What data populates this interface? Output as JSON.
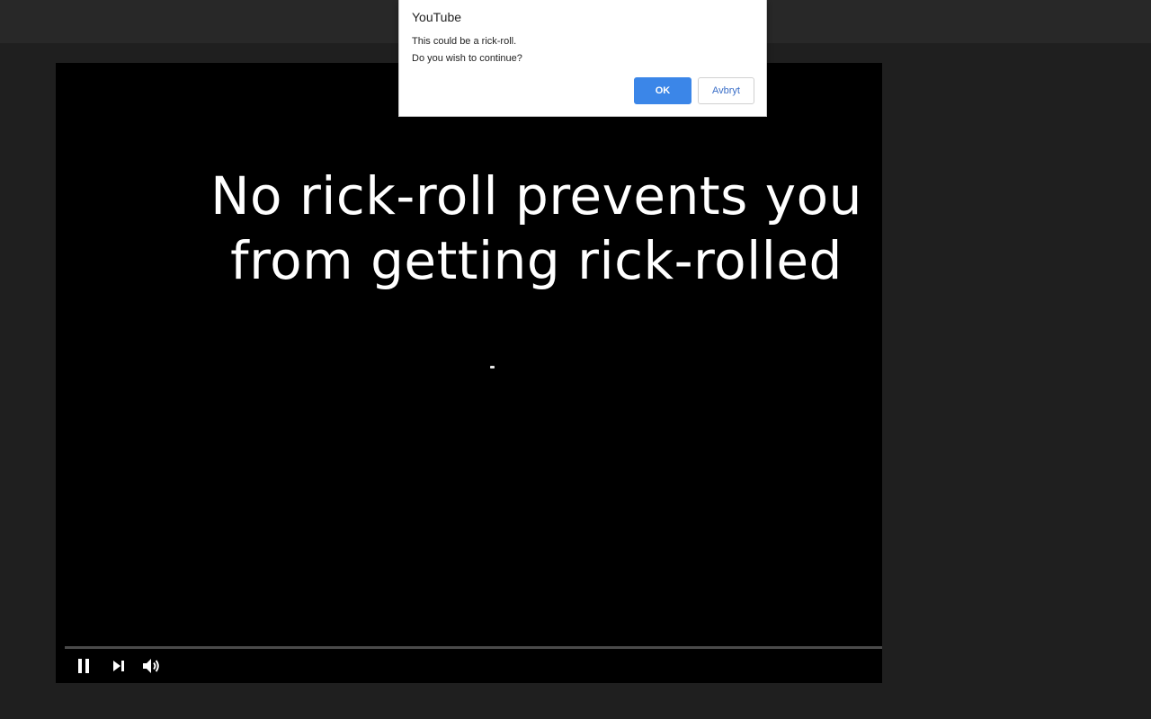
{
  "dialog": {
    "title": "YouTube",
    "message_line1": "This could be a rick-roll.",
    "message_line2": "Do you wish to continue?",
    "ok_label": "OK",
    "cancel_label": "Avbryt",
    "accent_color": "#3b86e8"
  },
  "video": {
    "caption_line1": "No rick-roll prevents you",
    "caption_line2": "from getting rick-rolled",
    "progress_fraction": 0.0
  },
  "controls": {
    "play_pause_icon": "pause-icon",
    "next_icon": "next-icon",
    "volume_icon": "volume-icon"
  }
}
